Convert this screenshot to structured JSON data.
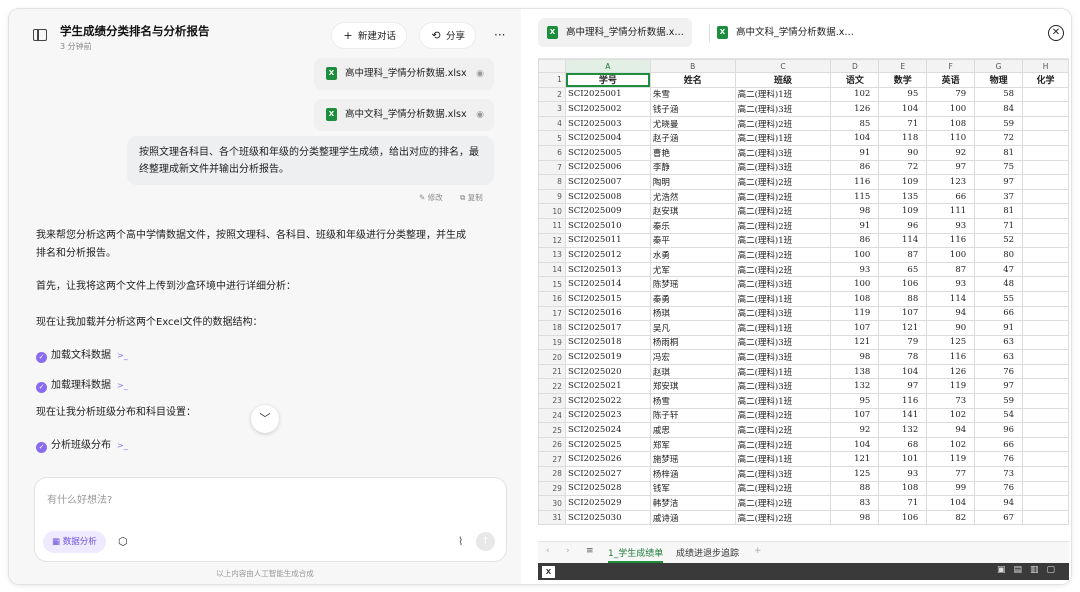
{
  "chat": {
    "title": "学生成绩分类排名与分析报告",
    "subtitle": "3 分钟前",
    "new_chat_label": "新建对话",
    "share_label": "分享",
    "more_label": "···",
    "attachments": [
      "高中理科_学情分析数据.xlsx",
      "高中文科_学情分析数据.xlsx"
    ],
    "user_message": "按照文理各科目、各个班级和年级的分类整理学生成绩，给出对应的排名，最终整理成新文件并输出分析报告。",
    "edit_label": "修改",
    "copy_label": "复制",
    "assistant": {
      "intro": [
        "我来帮您分析这两个高中学情数据文件，按照文理科、各科目、班级和年级进行分类整理，并生成",
        "排名和分析报告。"
      ],
      "upload": "首先，让我将这两个文件上传到沙盒环境中进行详细分析：",
      "load_intro": "现在让我加载并分析这两个Excel文件的数据结构：",
      "steps": [
        "加载文科数据",
        "加载理科数据"
      ],
      "dist_intro": "现在让我分析班级分布和科目设置：",
      "step3": "分析班级分布"
    },
    "input_placeholder": "有什么好想法?",
    "chip_label": "数据分析",
    "disclaimer": "以上内容由人工智能生成合成"
  },
  "viewer": {
    "tabs": [
      "高中理科_学情分析数据.x…",
      "高中文科_学情分析数据.x…"
    ],
    "sheet_tabs": [
      "1_学生成绩单",
      "成绩进退步追踪"
    ],
    "columns": [
      "A",
      "B",
      "C",
      "D",
      "E",
      "F",
      "G",
      "H"
    ],
    "header_row": [
      "学号",
      "姓名",
      "班级",
      "语文",
      "数学",
      "英语",
      "物理",
      "化学"
    ],
    "rows": [
      [
        "SCI2025001",
        "朱雪",
        "高二(理科)1班",
        "102",
        "95",
        "79",
        "58"
      ],
      [
        "SCI2025002",
        "钱子涵",
        "高二(理科)3班",
        "126",
        "104",
        "100",
        "84"
      ],
      [
        "SCI2025003",
        "尤晓曼",
        "高二(理科)2班",
        "85",
        "71",
        "108",
        "59"
      ],
      [
        "SCI2025004",
        "赵子涵",
        "高二(理科)1班",
        "104",
        "118",
        "110",
        "72"
      ],
      [
        "SCI2025005",
        "曹艳",
        "高二(理科)3班",
        "91",
        "90",
        "92",
        "81"
      ],
      [
        "SCI2025006",
        "李静",
        "高二(理科)3班",
        "86",
        "72",
        "97",
        "75"
      ],
      [
        "SCI2025007",
        "陶明",
        "高二(理科)2班",
        "116",
        "109",
        "123",
        "97"
      ],
      [
        "SCI2025008",
        "尤浩然",
        "高二(理科)2班",
        "115",
        "135",
        "66",
        "37"
      ],
      [
        "SCI2025009",
        "赵安琪",
        "高二(理科)2班",
        "98",
        "109",
        "111",
        "81"
      ],
      [
        "SCI2025010",
        "秦乐",
        "高二(理科)2班",
        "91",
        "96",
        "93",
        "71"
      ],
      [
        "SCI2025011",
        "秦平",
        "高二(理科)1班",
        "86",
        "114",
        "116",
        "52"
      ],
      [
        "SCI2025012",
        "水勇",
        "高二(理科)2班",
        "100",
        "87",
        "100",
        "80"
      ],
      [
        "SCI2025013",
        "尤军",
        "高二(理科)2班",
        "93",
        "65",
        "87",
        "47"
      ],
      [
        "SCI2025014",
        "陈梦瑶",
        "高二(理科)3班",
        "100",
        "106",
        "93",
        "48"
      ],
      [
        "SCI2025015",
        "秦勇",
        "高二(理科)1班",
        "108",
        "88",
        "114",
        "55"
      ],
      [
        "SCI2025016",
        "杨琪",
        "高二(理科)3班",
        "119",
        "107",
        "94",
        "66"
      ],
      [
        "SCI2025017",
        "吴凡",
        "高二(理科)1班",
        "107",
        "121",
        "90",
        "91"
      ],
      [
        "SCI2025018",
        "杨雨桐",
        "高二(理科)3班",
        "121",
        "79",
        "125",
        "63"
      ],
      [
        "SCI2025019",
        "冯宏",
        "高二(理科)3班",
        "98",
        "78",
        "116",
        "63"
      ],
      [
        "SCI2025020",
        "赵琪",
        "高二(理科)1班",
        "138",
        "104",
        "126",
        "76"
      ],
      [
        "SCI2025021",
        "郑安琪",
        "高二(理科)3班",
        "132",
        "97",
        "119",
        "97"
      ],
      [
        "SCI2025022",
        "杨雪",
        "高二(理科)1班",
        "95",
        "116",
        "73",
        "59"
      ],
      [
        "SCI2025023",
        "陈子轩",
        "高二(理科)2班",
        "107",
        "141",
        "102",
        "54"
      ],
      [
        "SCI2025024",
        "戚思",
        "高二(理科)2班",
        "92",
        "132",
        "94",
        "96"
      ],
      [
        "SCI2025025",
        "郑军",
        "高二(理科)2班",
        "104",
        "68",
        "102",
        "66"
      ],
      [
        "SCI2025026",
        "施梦瑶",
        "高二(理科)1班",
        "121",
        "101",
        "119",
        "76"
      ],
      [
        "SCI2025027",
        "杨梓涵",
        "高二(理科)3班",
        "125",
        "93",
        "77",
        "73"
      ],
      [
        "SCI2025028",
        "钱军",
        "高二(理科)2班",
        "88",
        "108",
        "99",
        "76"
      ],
      [
        "SCI2025029",
        "韩梦洁",
        "高二(理科)2班",
        "83",
        "71",
        "104",
        "94"
      ],
      [
        "SCI2025030",
        "戚诗涵",
        "高二(理科)2班",
        "98",
        "106",
        "82",
        "67"
      ]
    ]
  }
}
